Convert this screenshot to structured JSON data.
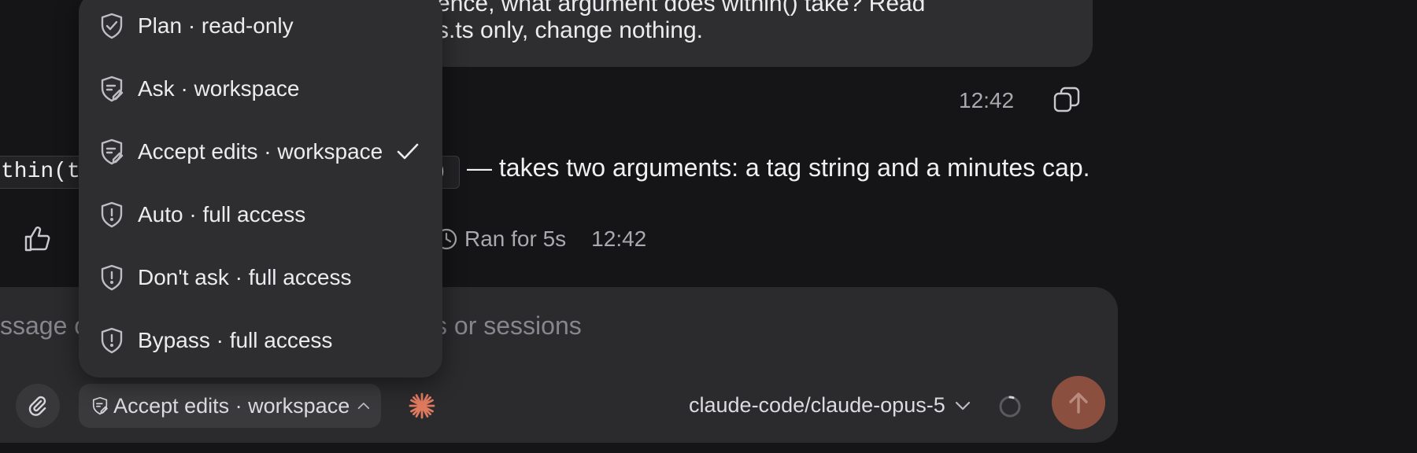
{
  "conversation": {
    "user_message": {
      "line1": "ntence, what argument does within() take? Read",
      "line2": "s.ts only, change nothing.",
      "timestamp": "12:42"
    },
    "assistant_message": {
      "code_prefix": "thin(t",
      "code_suffix": ")",
      "text": "— takes two arguments: a tag string and a minutes cap.",
      "ran_label": "Ran for 5s",
      "timestamp": "12:42"
    }
  },
  "composer": {
    "placeholder_left": "ssage o",
    "placeholder_right": "s or sessions",
    "mode_label": "Accept edits · workspace",
    "model_label": "claude-code/claude-opus-5"
  },
  "permission_menu": {
    "items": [
      {
        "label": "Plan · read-only",
        "icon": "shield-check-icon",
        "selected": false
      },
      {
        "label": "Ask · workspace",
        "icon": "shield-edit-icon",
        "selected": false
      },
      {
        "label": "Accept edits · workspace",
        "icon": "shield-edit-icon",
        "selected": true
      },
      {
        "label": "Auto · full access",
        "icon": "shield-alert-icon",
        "selected": false
      },
      {
        "label": "Don't ask · full access",
        "icon": "shield-alert-icon",
        "selected": false
      },
      {
        "label": "Bypass · full access",
        "icon": "shield-alert-icon",
        "selected": false
      }
    ]
  },
  "colors": {
    "background": "#151517",
    "surface": "#2b2b2e",
    "menu": "#2e2e31",
    "accent_send": "#8a4f3f",
    "spark": "#e07a5f"
  }
}
